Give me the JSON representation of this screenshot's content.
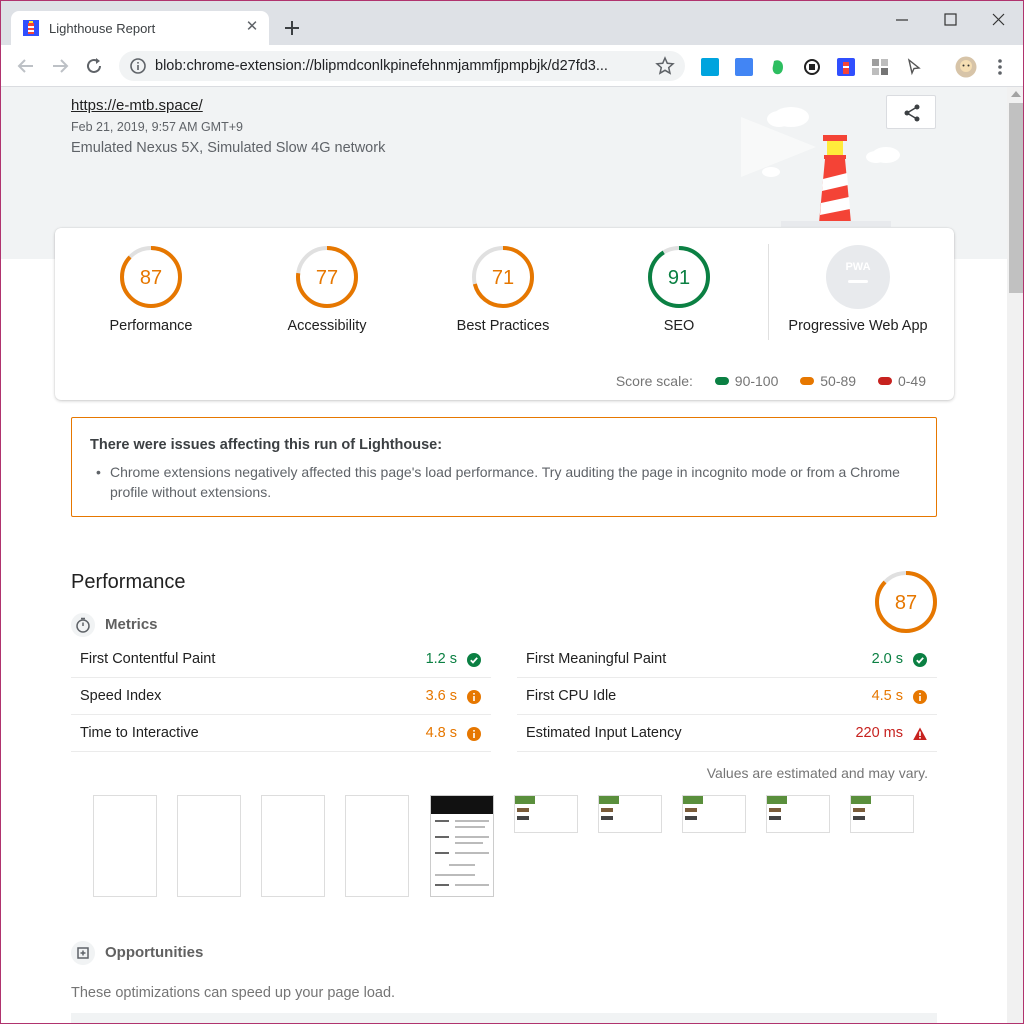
{
  "browser": {
    "tab_title": "Lighthouse Report",
    "tab_close": "✕",
    "url": "blob:chrome-extension://blipmdconlkpinefehnmjammfjpmpbjk/d27fd3...",
    "extensions": [
      "hatena-bookmark-icon",
      "google-translate-icon",
      "evernote-icon",
      "record-icon",
      "lighthouse-icon",
      "puzzle-icon",
      "cursor-icon",
      "profile-avatar"
    ]
  },
  "report": {
    "url": "https://e-mtb.space/",
    "fetch_time": "Feb 21, 2019, 9:57 AM GMT+9",
    "environment": "Emulated Nexus 5X, Simulated Slow 4G network"
  },
  "scores": [
    {
      "label": "Performance",
      "score": 87,
      "rating": "avg"
    },
    {
      "label": "Accessibility",
      "score": 77,
      "rating": "avg"
    },
    {
      "label": "Best Practices",
      "score": 71,
      "rating": "avg"
    },
    {
      "label": "SEO",
      "score": 91,
      "rating": "good"
    }
  ],
  "pwa": {
    "label": "Progressive Web App",
    "badge": "PWA"
  },
  "score_scale": {
    "label": "Score scale:",
    "ranges": [
      {
        "text": "90-100",
        "color": "#0b8043"
      },
      {
        "text": "50-89",
        "color": "#e67700"
      },
      {
        "text": "0-49",
        "color": "#c7221f"
      }
    ]
  },
  "warnings": {
    "title": "There were issues affecting this run of Lighthouse:",
    "items": [
      "Chrome extensions negatively affected this page's load performance. Try auditing the page in incognito mode or from a Chrome profile without extensions."
    ]
  },
  "performance": {
    "title": "Performance",
    "score": 87,
    "metrics_title": "Metrics",
    "metrics": [
      {
        "name": "First Contentful Paint",
        "value": "1.2 s",
        "rating": "good"
      },
      {
        "name": "First Meaningful Paint",
        "value": "2.0 s",
        "rating": "good"
      },
      {
        "name": "Speed Index",
        "value": "3.6 s",
        "rating": "avg"
      },
      {
        "name": "First CPU Idle",
        "value": "4.5 s",
        "rating": "avg"
      },
      {
        "name": "Time to Interactive",
        "value": "4.8 s",
        "rating": "avg"
      },
      {
        "name": "Estimated Input Latency",
        "value": "220 ms",
        "rating": "bad"
      }
    ],
    "estimated_note": "Values are estimated and may vary."
  },
  "opportunities": {
    "title": "Opportunities",
    "description": "These optimizations can speed up your page load."
  },
  "colors": {
    "good": "#0b8043",
    "avg": "#e67700",
    "bad": "#c7221f"
  }
}
